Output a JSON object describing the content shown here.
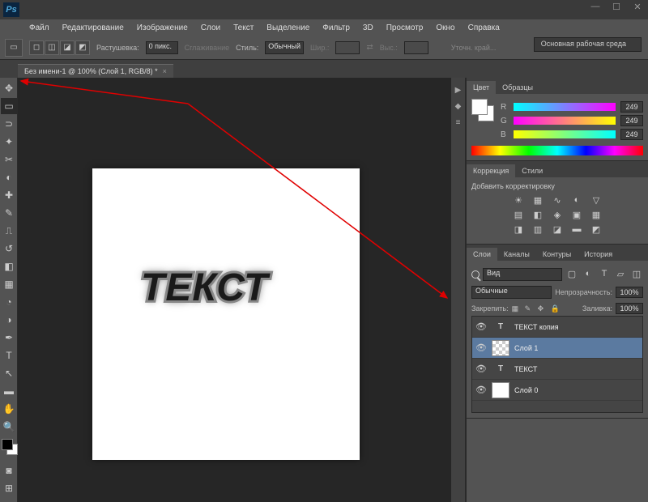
{
  "menu": [
    "Файл",
    "Редактирование",
    "Изображение",
    "Слои",
    "Текст",
    "Выделение",
    "Фильтр",
    "3D",
    "Просмотр",
    "Окно",
    "Справка"
  ],
  "options": {
    "feather_label": "Растушевка:",
    "feather_value": "0 пикс.",
    "antialias": "Сглаживание",
    "style_label": "Стиль:",
    "style_value": "Обычный",
    "width_label": "Шир.:",
    "height_label": "Выс.:",
    "refine": "Уточн. край...",
    "workspace": "Основная рабочая среда"
  },
  "doc_tab": "Без имени-1 @ 100% (Слой 1, RGB/8) *",
  "canvas_text": "ТЕКСТ",
  "color_panel": {
    "tabs": [
      "Цвет",
      "Образцы"
    ],
    "channels": [
      {
        "l": "R",
        "v": "249"
      },
      {
        "l": "G",
        "v": "249"
      },
      {
        "l": "B",
        "v": "249"
      }
    ]
  },
  "adjust_panel": {
    "tabs": [
      "Коррекция",
      "Стили"
    ],
    "title": "Добавить корректировку"
  },
  "layers_panel": {
    "tabs": [
      "Слои",
      "Каналы",
      "Контуры",
      "История"
    ],
    "kind_label": "Вид",
    "blend": "Обычные",
    "opacity_label": "Непрозрачность:",
    "opacity": "100%",
    "lock_label": "Закрепить:",
    "fill_label": "Заливка:",
    "fill": "100%",
    "layers": [
      {
        "name": "ТЕКСТ копия",
        "type": "T"
      },
      {
        "name": "Слой 1",
        "type": "checker",
        "selected": true
      },
      {
        "name": "ТЕКСТ",
        "type": "T"
      },
      {
        "name": "Слой 0",
        "type": "white"
      }
    ]
  }
}
